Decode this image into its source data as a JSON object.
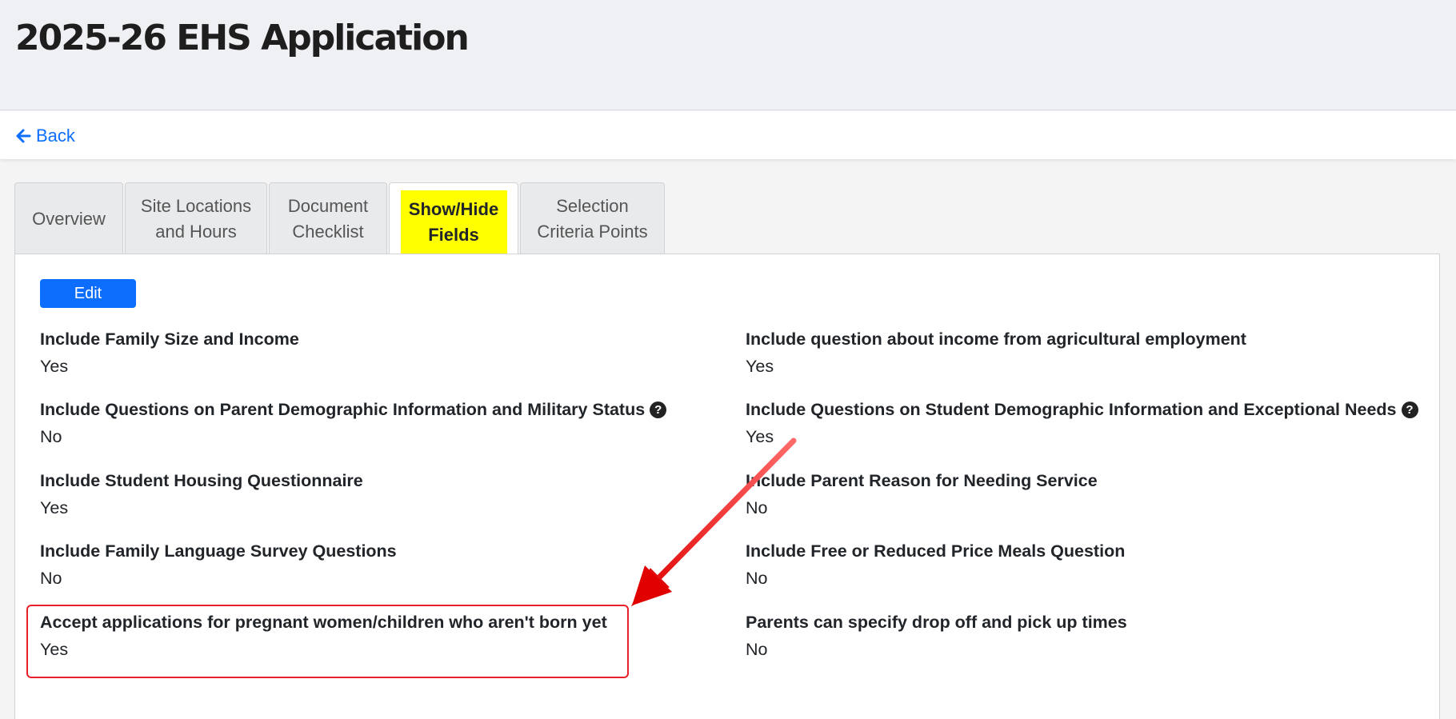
{
  "header": {
    "title": "2025-26 EHS Application"
  },
  "nav": {
    "back_label": "Back"
  },
  "tabs": [
    {
      "line1": "Overview",
      "line2": ""
    },
    {
      "line1": "Site Locations",
      "line2": "and Hours"
    },
    {
      "line1": "Document",
      "line2": "Checklist"
    },
    {
      "line1": "Show/Hide",
      "line2": "Fields"
    },
    {
      "line1": "Selection",
      "line2": "Criteria Points"
    }
  ],
  "toolbar": {
    "edit_label": "Edit"
  },
  "fields": [
    {
      "label": "Include Family Size and Income",
      "value": "Yes"
    },
    {
      "label": "Include question about income from agricultural employment",
      "value": "Yes"
    },
    {
      "label": "Include Questions on Parent Demographic Information and Military Status",
      "value": "No"
    },
    {
      "label": "Include Questions on Student Demographic Information and Exceptional Needs",
      "value": "Yes"
    },
    {
      "label": "Include Student Housing Questionnaire",
      "value": "Yes"
    },
    {
      "label": "Include Parent Reason for Needing Service",
      "value": "No"
    },
    {
      "label": "Include Family Language Survey Questions",
      "value": "No"
    },
    {
      "label": "Include Free or Reduced Price Meals Question",
      "value": "No"
    },
    {
      "label": "Accept applications for pregnant women/children who aren't born yet",
      "value": "Yes"
    },
    {
      "label": "Parents can specify drop off and pick up times",
      "value": "No"
    }
  ],
  "icons": {
    "back": "arrow-left-icon",
    "help": "question-circle-icon"
  },
  "colors": {
    "accent": "#0d6efd",
    "tab_highlight": "#ffff00",
    "annotation": "#e8202a"
  }
}
